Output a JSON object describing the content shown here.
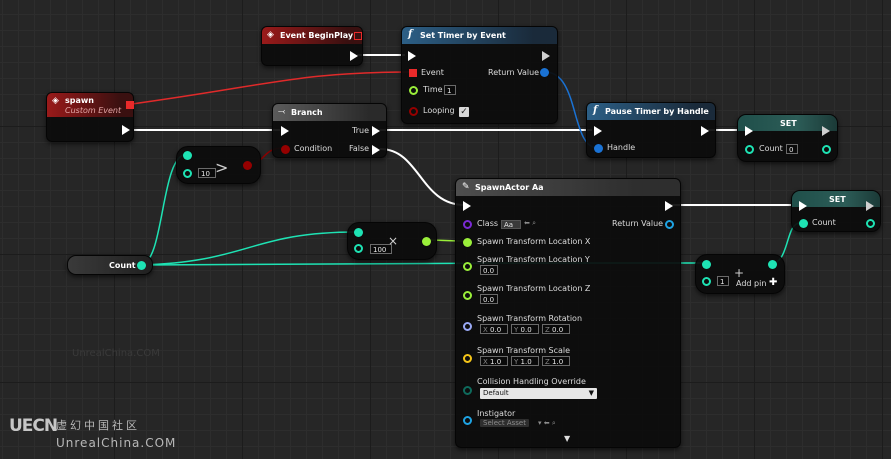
{
  "nodes": {
    "event_beginplay": {
      "title": "Event BeginPlay"
    },
    "spawn_event": {
      "title": "spawn",
      "subtitle": "Custom Event"
    },
    "set_timer": {
      "title": "Set Timer by Event",
      "event_label": "Event",
      "return_label": "Return Value",
      "time_label": "Time",
      "time_value": "1",
      "looping_label": "Looping"
    },
    "branch": {
      "title": "Branch",
      "condition_label": "Condition",
      "true_label": "True",
      "false_label": "False"
    },
    "greater": {
      "value": "10",
      "symbol": ">"
    },
    "pause_timer": {
      "title": "Pause Timer by Handle",
      "handle_label": "Handle"
    },
    "set_top": {
      "title": "SET",
      "count_label": "Count",
      "count_value": "0"
    },
    "count_get": {
      "title": "Count"
    },
    "multiply": {
      "value": "100",
      "symbol": "×"
    },
    "spawn_actor": {
      "title": "SpawnActor Aa",
      "class_label": "Class",
      "class_value": "Aa",
      "return_label": "Return Value",
      "loc_x_label": "Spawn Transform Location X",
      "loc_y_label": "Spawn Transform Location Y",
      "loc_y_value": "0.0",
      "loc_z_label": "Spawn Transform Location Z",
      "loc_z_value": "0.0",
      "rot_label": "Spawn Transform Rotation",
      "rot_x": "0.0",
      "rot_y": "0.0",
      "rot_z": "0.0",
      "scale_label": "Spawn Transform Scale",
      "scale_x": "1.0",
      "scale_y": "1.0",
      "scale_z": "1.0",
      "collision_label": "Collision Handling Override",
      "collision_value": "Default",
      "instigator_label": "Instigator",
      "instigator_value": "Select Asset",
      "axis_x": "X",
      "axis_y": "Y",
      "axis_z": "Z"
    },
    "set_bottom": {
      "title": "SET",
      "count_label": "Count"
    },
    "add": {
      "value": "1",
      "add_pin_label": "Add pin",
      "symbol": "+"
    }
  },
  "watermark": {
    "logo": "UECN",
    "cn": "虚幻中国社区",
    "en": "UnrealChina.COM",
    "ghost": "UnrealChina.COM"
  },
  "colors": {
    "exec": "#ffffff",
    "integer": "#1ee3b4",
    "float": "#9aef3a",
    "vector": "#f5c518",
    "rotator": "#9aa9f5",
    "struct_handle": "#1a72d4",
    "boolean": "#950000",
    "delegate": "#ea2a2a",
    "object": "#1ea3e3",
    "class": "#7a2ad4",
    "byte": "#0e6a5c"
  }
}
